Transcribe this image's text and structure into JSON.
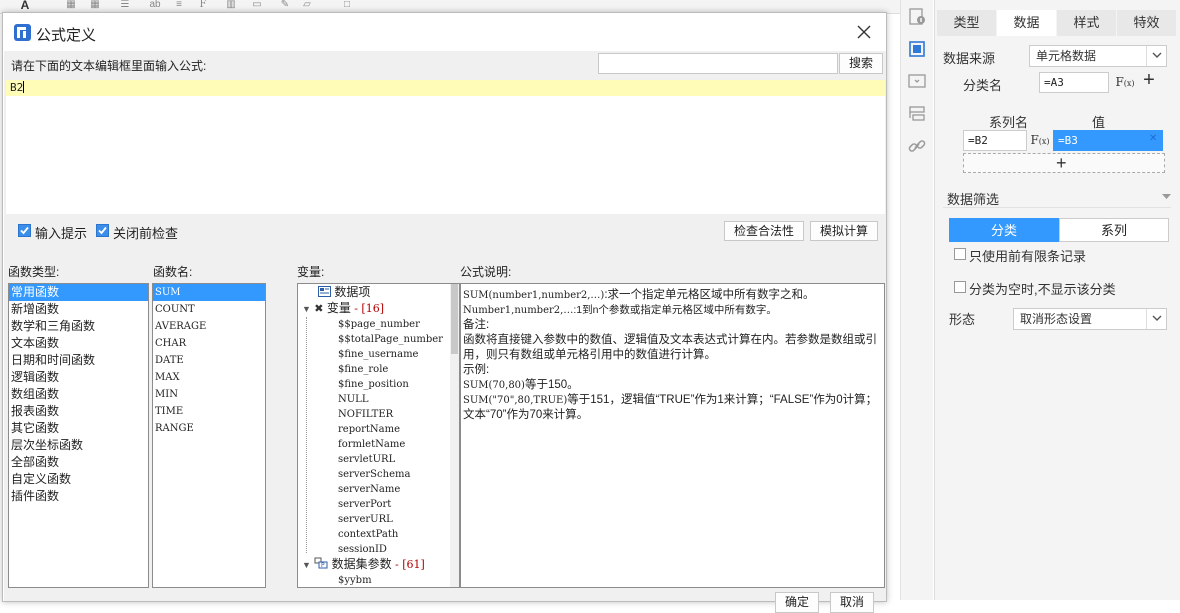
{
  "app_toolbar": {
    "items": [
      "font-color-icon",
      "table-icon",
      "grid-icon",
      "formula-icon",
      "chart-icon",
      "image-icon",
      "border-icon"
    ]
  },
  "dialog": {
    "title": "公式定义",
    "prompt": "请在下面的文本编辑框里面输入公式:",
    "search_value": "",
    "search_button": "搜索",
    "formula_text": "B2",
    "checkbox_input_hint": {
      "label": "输入提示",
      "checked": true
    },
    "checkbox_check_before_close": {
      "label": "关闭前检查",
      "checked": true
    },
    "check_validity_button": "检查合法性",
    "simulate_button": "模拟计算",
    "function_types_label": "函数类型:",
    "function_names_label": "函数名:",
    "variables_label": "变量:",
    "description_label": "公式说明:",
    "function_types": [
      "常用函数",
      "新增函数",
      "数学和三角函数",
      "文本函数",
      "日期和时间函数",
      "逻辑函数",
      "数组函数",
      "报表函数",
      "其它函数",
      "层次坐标函数",
      "全部函数",
      "自定义函数",
      "插件函数"
    ],
    "function_types_selected": 0,
    "function_names": [
      "SUM",
      "COUNT",
      "AVERAGE",
      "CHAR",
      "DATE",
      "MAX",
      "MIN",
      "TIME",
      "RANGE"
    ],
    "function_names_selected": 0,
    "variables": {
      "data_item": "数据项",
      "variable_group": "变量",
      "variable_count": "[16]",
      "variable_items": [
        "$$page_number",
        "$$totalPage_number",
        "$fine_username",
        "$fine_role",
        "$fine_position",
        "NULL",
        "NOFILTER",
        "reportName",
        "formletName",
        "servletURL",
        "serverSchema",
        "serverName",
        "serverPort",
        "serverURL",
        "contextPath",
        "sessionID"
      ],
      "dataset_group": "数据集参数",
      "dataset_count": "[61]",
      "dataset_items": [
        "$yybm"
      ]
    },
    "description": [
      {
        "code": "SUM(number1,number2,…)",
        "text": ":求一个指定单元格区域中所有数字之和。"
      },
      {
        "code": "Number1,number2,…",
        "text": ":1到n个参数或指定单元格区域中所有数字。"
      },
      {
        "code": "",
        "text": "备注:"
      },
      {
        "code": "",
        "text": "函数将直接键入参数中的数值、逻辑值及文本表达式计算在内。若参数是数组或引用，则只有数组或单元格引用中的数值进行计算。"
      },
      {
        "code": "",
        "text": "示例:"
      },
      {
        "code": "SUM(70,80)",
        "text": "等于150。"
      },
      {
        "code": "SUM(\"70\",80,TRUE)",
        "text": "等于151，逻辑值“TRUE”作为1来计算；“FALSE”作为0计算；文本“70”作为70来计算。"
      }
    ],
    "ok_button": "确定",
    "cancel_button": "取消"
  },
  "side_strip": {
    "icons": [
      "cell-attribute-icon",
      "cell-element-icon",
      "widget-icon",
      "condition-icon",
      "hyperlink-icon"
    ]
  },
  "panel": {
    "tabs": [
      "类型",
      "数据",
      "样式",
      "特效"
    ],
    "active_tab": 1,
    "data_source_label": "数据来源",
    "data_source_value": "单元格数据",
    "category_label": "分类名",
    "category_value": "=A3",
    "fx_label": "F(x)",
    "series_name_header": "系列名",
    "value_header": "值",
    "series_name_value": "=B2",
    "series_value_value": "=B3",
    "filter_label": "数据筛选",
    "seg_category": "分类",
    "seg_series": "系列",
    "only_limited_label": "只使用前有限条记录",
    "hide_empty_label": "分类为空时,不显示该分类",
    "shape_label": "形态",
    "shape_value": "取消形态设置",
    "colors": {
      "accent": "#3399ff",
      "selected_row": "#3399ff",
      "formula_bg": "#fffcb7"
    }
  }
}
